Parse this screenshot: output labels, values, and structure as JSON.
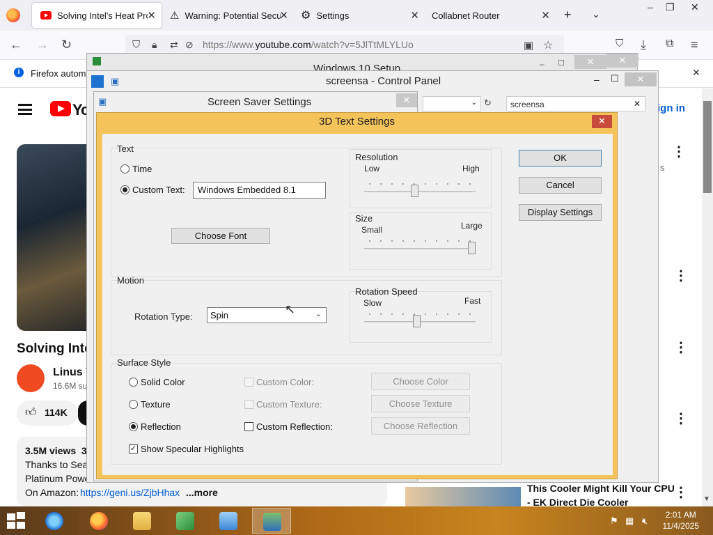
{
  "browser": {
    "tabs": [
      {
        "title": "Solving Intel's Heat Prob",
        "active": true
      },
      {
        "title": "Warning: Potential Secur",
        "active": false
      },
      {
        "title": "Settings",
        "active": false
      },
      {
        "title": "Collabnet Router",
        "active": false
      }
    ],
    "url": {
      "prefix": "https://www.",
      "host": "youtube.com",
      "path": "/watch?v=5JlTtMLYLUo"
    },
    "infobar_text": "Firefox automa"
  },
  "youtube": {
    "logo_text": "Yo",
    "signin": "ign in",
    "video_title": "Solving Inte",
    "channel_name": "Linus T",
    "subscribers": "16.6M su",
    "likes": "114K",
    "views": "3.5M views  3",
    "desc_line1": "Thanks to Sea",
    "desc_line2": "Platinum Power S",
    "desc_line3_prefix": "On Amazon:",
    "desc_link": "https://geni.us/ZjbHhax",
    "desc_more": "...more",
    "side_text": "s",
    "rec_title_line1": "This Cooler Might Kill Your CPU",
    "rec_title_line2": "- EK Direct Die Cooler"
  },
  "windows": {
    "setup_title": "Windows 10 Setup",
    "control_panel_title": "screensa - Control Panel",
    "control_panel_search": "screensa",
    "screensaver_title": "Screen Saver Settings"
  },
  "dialog": {
    "title": "3D Text Settings",
    "text_group": {
      "label": "Text",
      "time_label": "Time",
      "custom_text_label": "Custom Text:",
      "custom_text_value": "Windows Embedded 8.1",
      "choose_font": "Choose Font",
      "selected": "custom"
    },
    "resolution": {
      "label": "Resolution",
      "low": "Low",
      "high": "High",
      "value": 0.45
    },
    "size": {
      "label": "Size",
      "small": "Small",
      "large": "Large",
      "value": 1.0
    },
    "motion": {
      "label": "Motion",
      "rotation_type_label": "Rotation Type:",
      "rotation_type_value": "Spin",
      "speed_label": "Rotation Speed",
      "slow": "Slow",
      "fast": "Fast",
      "speed_value": 0.47
    },
    "surface": {
      "label": "Surface Style",
      "solid_color": "Solid Color",
      "texture": "Texture",
      "reflection": "Reflection",
      "selected": "reflection",
      "custom_color": "Custom Color:",
      "custom_texture": "Custom Texture:",
      "custom_reflection": "Custom Reflection:",
      "choose_color": "Choose Color",
      "choose_texture": "Choose Texture",
      "choose_reflection": "Choose Reflection",
      "specular_label": "Show Specular Highlights",
      "specular_checked": true
    },
    "buttons": {
      "ok": "OK",
      "cancel": "Cancel",
      "display_settings": "Display Settings"
    }
  },
  "taskbar": {
    "time": "2:01 AM",
    "date": "11/4/2025"
  }
}
